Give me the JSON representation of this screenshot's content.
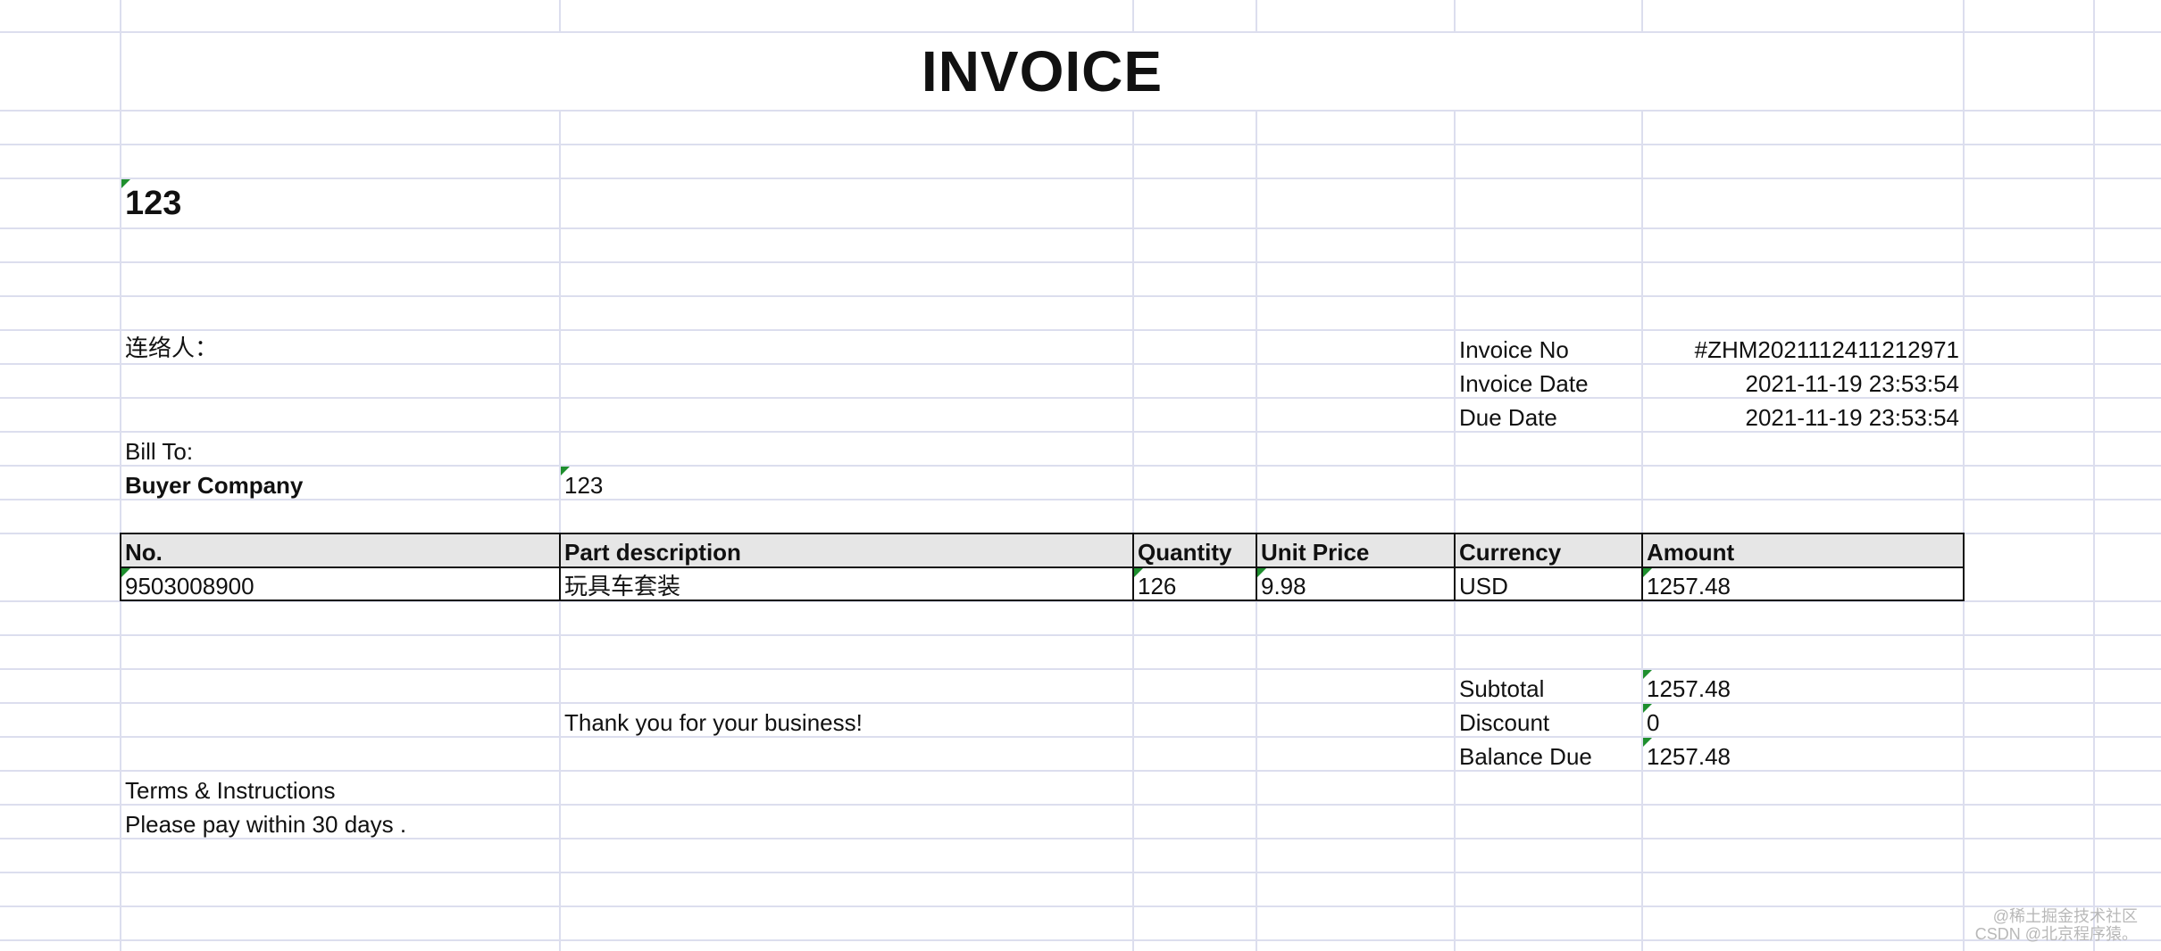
{
  "invoice": {
    "title": "INVOICE",
    "company": "123",
    "contact_label": "连络人：",
    "invoice_no_label": "Invoice No",
    "invoice_no": "#ZHM2021112411212971",
    "invoice_date_label": "Invoice Date",
    "invoice_date": "2021-11-19 23:53:54",
    "due_date_label": "Due  Date",
    "due_date": "2021-11-19 23:53:54",
    "bill_to_label": "Bill To:",
    "buyer_company_label": "Buyer Company",
    "buyer_company": "123"
  },
  "table": {
    "headers": [
      "No.",
      "Part description",
      "Quantity",
      "Unit Price",
      "Currency",
      "Amount"
    ],
    "rows": [
      [
        "9503008900",
        "玩具车套装",
        "126",
        "9.98",
        "USD",
        "1257.48"
      ]
    ]
  },
  "totals": {
    "subtotal_label": "Subtotal",
    "subtotal": "1257.48",
    "discount_label": "Discount",
    "discount": "0",
    "balance_due_label": "Balance Due",
    "balance_due": "1257.48"
  },
  "thanks": "Thank you for your business!",
  "terms": {
    "label": "Terms & Instructions",
    "text": "Please pay within 30 days ."
  },
  "watermark": {
    "line1": "@稀土掘金技术社区",
    "line2": "CSDN @北京程序猿。"
  },
  "colors": {
    "grid": "#dcdeee",
    "header_fill": "#e6e6e6",
    "comment_marker": "#1e8f2e"
  }
}
